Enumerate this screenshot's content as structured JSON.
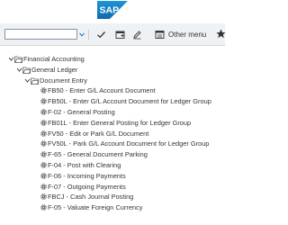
{
  "header": {
    "logo_text": "SAP",
    "brand_color": "#1173b3"
  },
  "toolbar": {
    "command_field_value": "",
    "other_menu_label": "Other menu",
    "icons": [
      "dropdown-icon",
      "check-icon",
      "add-favorite-icon",
      "edit-favorite-icon",
      "other-menu-icon",
      "star-icon"
    ]
  },
  "tree": {
    "items": [
      {
        "label": "Financial Accounting",
        "type": "folder"
      },
      {
        "label": "General Ledger",
        "type": "folder"
      },
      {
        "label": "Document Entry",
        "type": "folder"
      },
      {
        "label": "FB50 - Enter G/L Account Document",
        "type": "transaction"
      },
      {
        "label": "FB50L - Enter G/L Account Document for Ledger Group",
        "type": "transaction"
      },
      {
        "label": "F-02 - General Posting",
        "type": "transaction"
      },
      {
        "label": "FB01L - Enter General Posting for Ledger Group",
        "type": "transaction"
      },
      {
        "label": "FV50 - Edit or Park G/L Document",
        "type": "transaction"
      },
      {
        "label": "FV50L - Park G/L Account Document for Ledger Group",
        "type": "transaction"
      },
      {
        "label": "F-65 - General Document Parking",
        "type": "transaction"
      },
      {
        "label": "F-04 - Post with Clearing",
        "type": "transaction"
      },
      {
        "label": "F-06 - Incoming Payments",
        "type": "transaction"
      },
      {
        "label": "F-07 - Outgoing Payments",
        "type": "transaction"
      },
      {
        "label": "FBCJ - Cash Journal Posting",
        "type": "transaction"
      },
      {
        "label": "F-05 - Valuate Foreign Currency",
        "type": "transaction"
      }
    ]
  }
}
